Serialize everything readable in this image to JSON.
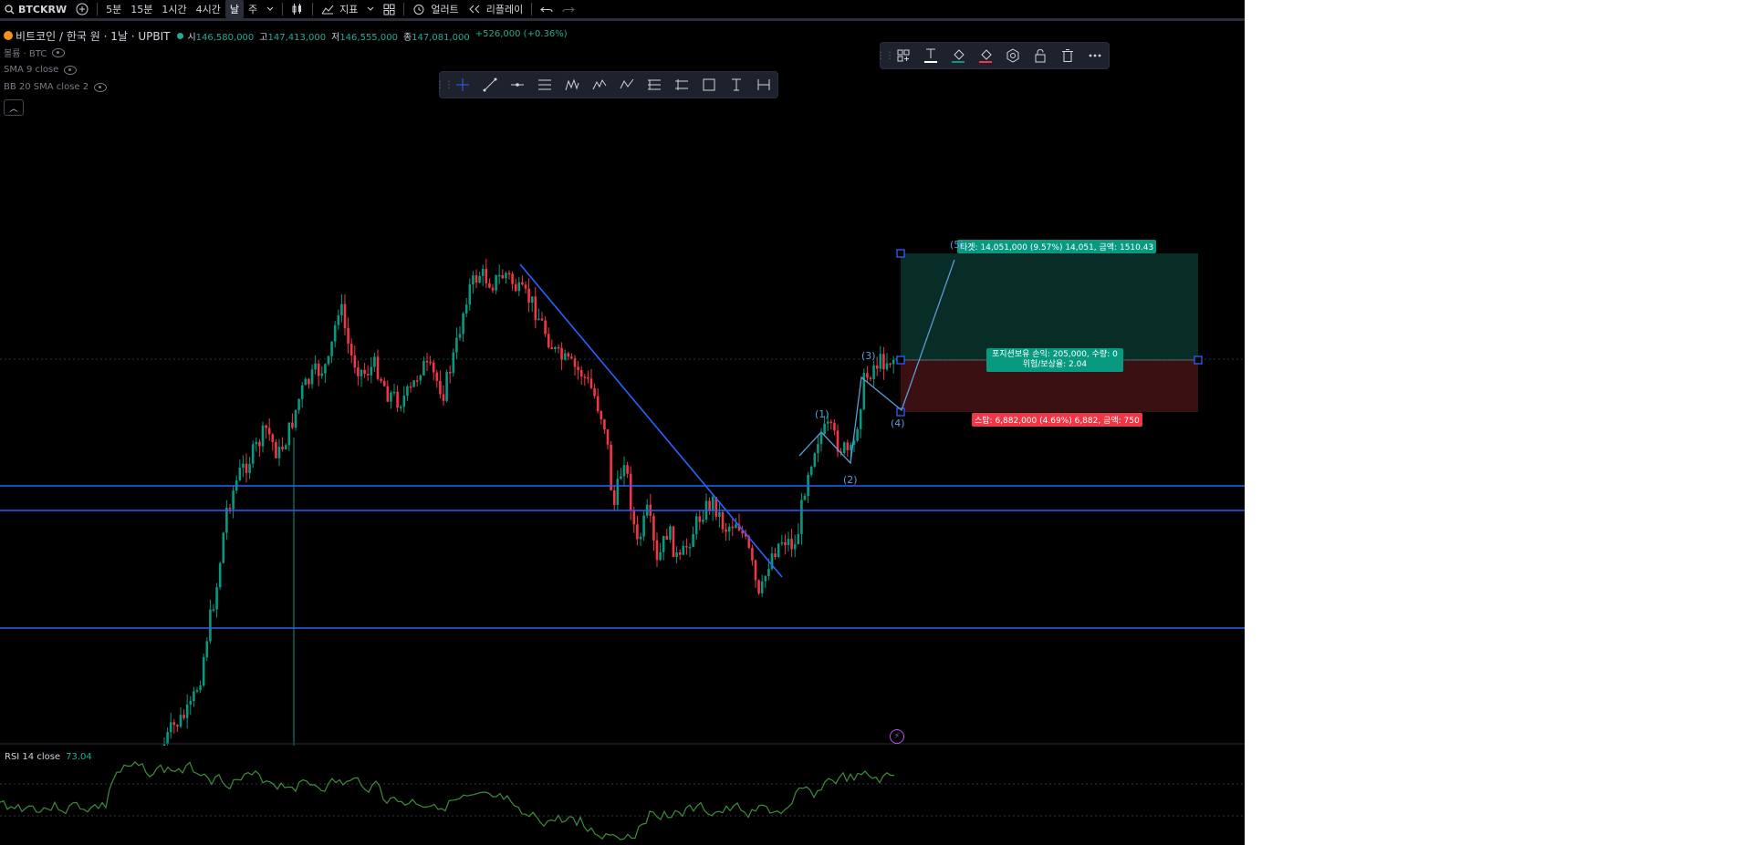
{
  "symbol": "BTCKRW",
  "toolbar": {
    "intervals": [
      "5분",
      "15분",
      "1시간",
      "4시간",
      "날",
      "주"
    ],
    "active_interval": "날",
    "indicators_label": "지표",
    "alert_label": "얼러트",
    "replay_label": "리플레이"
  },
  "legend": {
    "title": "비트코인 / 한국 원 · 1날 · UPBIT",
    "open_label": "시",
    "open": "146,580,000",
    "high_label": "고",
    "high": "147,413,000",
    "low_label": "저",
    "low": "146,555,000",
    "close_label": "종",
    "close": "147,081,000",
    "change": "+526,000 (+0.36%)",
    "indicators": [
      "볼륨 · BTC",
      "SMA 9 close",
      "BB 20 SMA close 2"
    ]
  },
  "position": {
    "target_label": "타겟: 14,051,000 (9.57%) 14,051, 금액: 1510.43",
    "stop_label": "스탑: 6,882,000 (4.69%) 6,882, 금액: 750",
    "pnl_label": "포지션보유 손익: 205,000, 수량: 0",
    "rr_label": "위험/보상율: 2.04"
  },
  "waves": [
    "(1)",
    "(2)",
    "(3)",
    "(4)",
    "(5)"
  ],
  "rsi": {
    "label": "RSI 14 close",
    "value": "73.04"
  },
  "colors": {
    "background": "#000000",
    "up": "#089981",
    "down": "#f23645",
    "line": "#2962ff",
    "rsi": "#3e8e3e"
  }
}
